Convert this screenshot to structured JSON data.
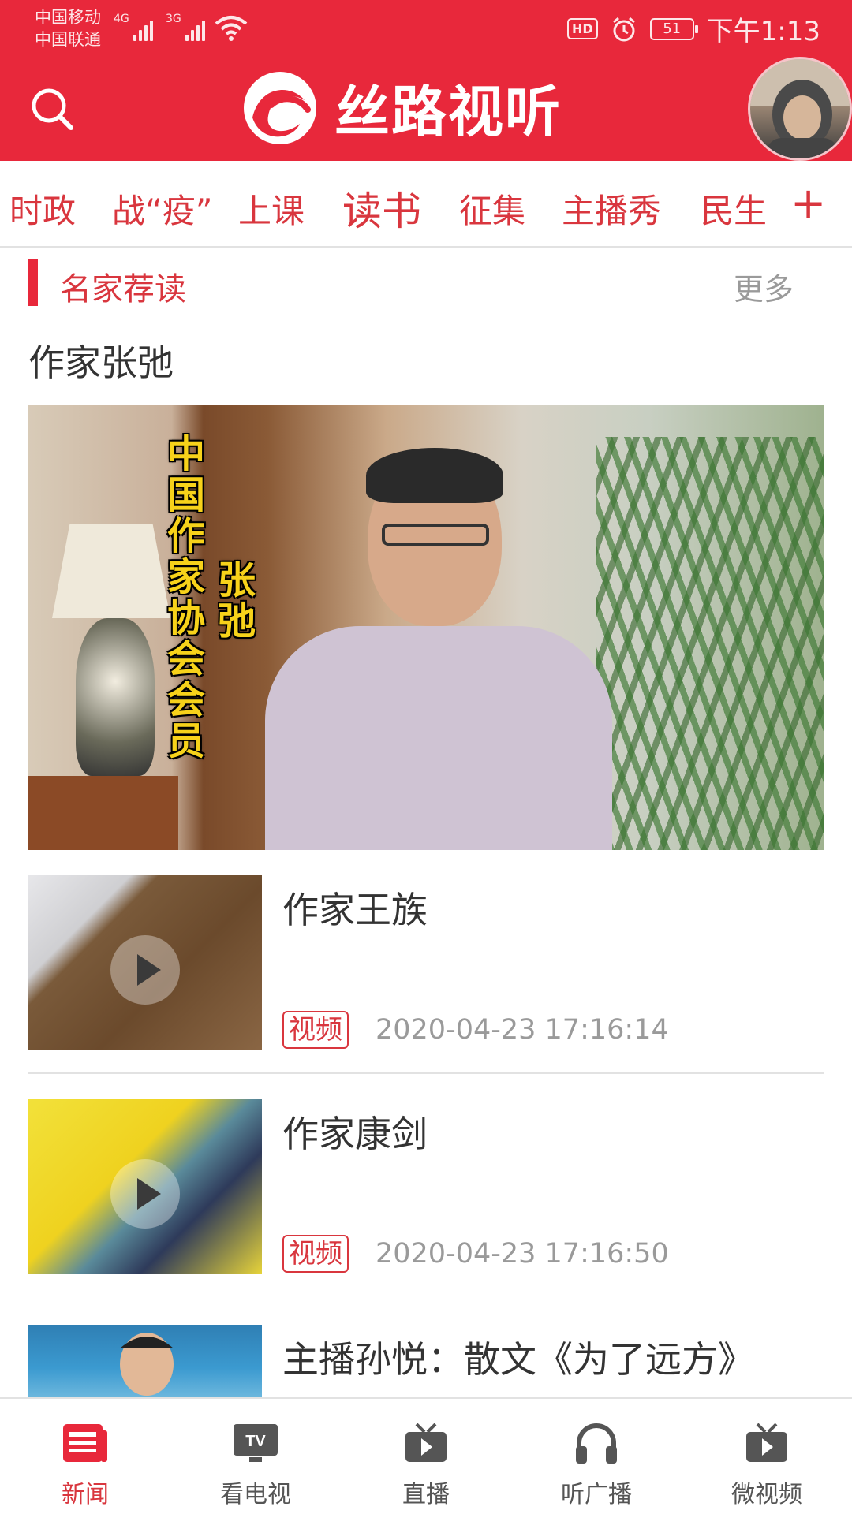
{
  "status_bar": {
    "carrier_1": "中国移动",
    "carrier_2": "中国联通",
    "network_1": "4G",
    "network_2": "3G",
    "hd": "HD",
    "battery": "51",
    "time": "下午1:13"
  },
  "header": {
    "app_name": "丝路视听",
    "brand_color": "#e8283b"
  },
  "tabs": [
    {
      "label": "时政"
    },
    {
      "label": "战“疫”"
    },
    {
      "label": "上课"
    },
    {
      "label": "读书",
      "active": true
    },
    {
      "label": "征集"
    },
    {
      "label": "主播秀"
    },
    {
      "label": "民生"
    }
  ],
  "tab_plus": "+",
  "section": {
    "title": "名家荐读",
    "more": "更多"
  },
  "featured": {
    "title": "作家张弛",
    "caption_1": "中国作家协会会员",
    "caption_2": "张弛"
  },
  "items": [
    {
      "title": "作家王族",
      "tag": "视频",
      "time": "2020-04-23 17:16:14"
    },
    {
      "title": "作家康剑",
      "tag": "视频",
      "time": "2020-04-23 17:16:50"
    },
    {
      "title": "主播孙悦：散文《为了远方》"
    }
  ],
  "bottom_nav": [
    {
      "label": "新闻",
      "icon": "news-icon",
      "active": true
    },
    {
      "label": "看电视",
      "icon": "tv-icon"
    },
    {
      "label": "直播",
      "icon": "live-icon"
    },
    {
      "label": "听广播",
      "icon": "headphones-icon"
    },
    {
      "label": "微视频",
      "icon": "video-icon"
    }
  ],
  "colors": {
    "accent": "#d9363e",
    "muted": "#9a9a9a"
  }
}
